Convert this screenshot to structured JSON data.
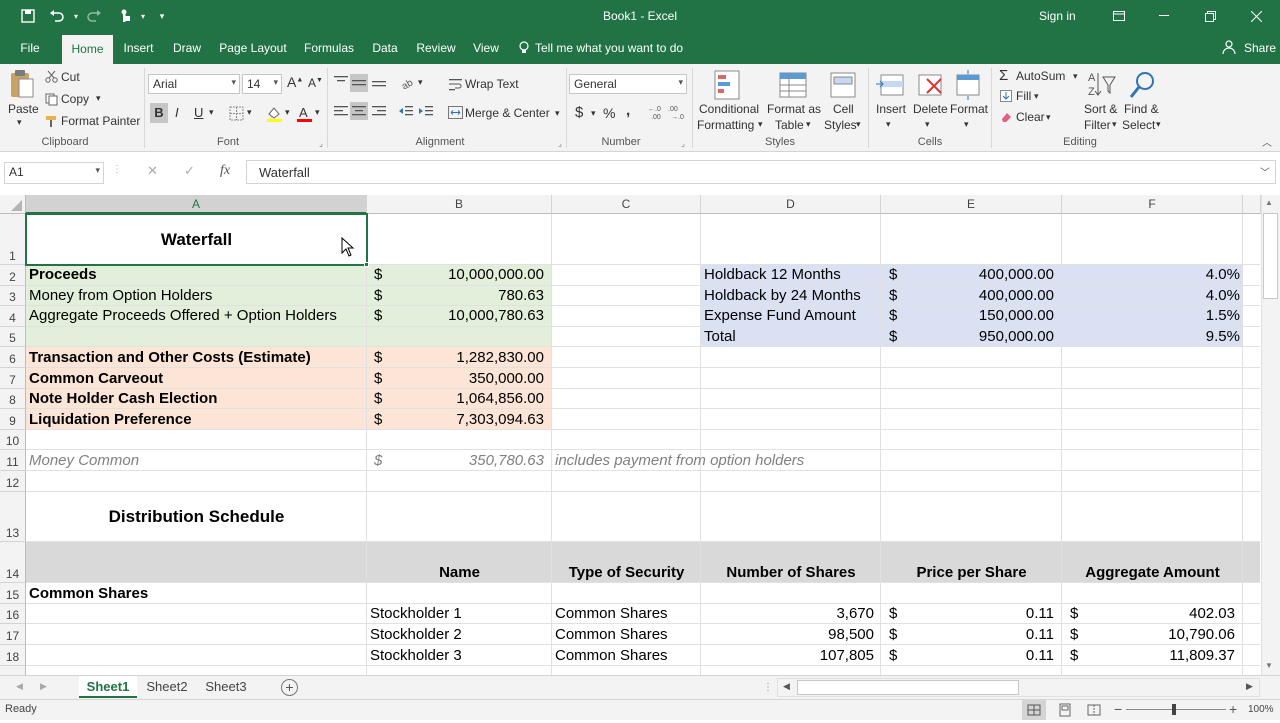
{
  "window": {
    "title": "Book1 - Excel",
    "sign_in": "Sign in"
  },
  "tabs": [
    {
      "label": "File"
    },
    {
      "label": "Home"
    },
    {
      "label": "Insert"
    },
    {
      "label": "Draw"
    },
    {
      "label": "Page Layout"
    },
    {
      "label": "Formulas"
    },
    {
      "label": "Data"
    },
    {
      "label": "Review"
    },
    {
      "label": "View"
    }
  ],
  "tell_me": "Tell me what you want to do",
  "share": "Share",
  "ribbon": {
    "clipboard": {
      "paste": "Paste",
      "cut": "Cut",
      "copy": "Copy",
      "format_painter": "Format Painter",
      "label": "Clipboard"
    },
    "font": {
      "name": "Arial",
      "size": "14",
      "bold": "B",
      "italic": "I",
      "underline": "U",
      "label": "Font"
    },
    "alignment": {
      "wrap_text": "Wrap Text",
      "merge_center": "Merge & Center",
      "label": "Alignment"
    },
    "number": {
      "format": "General",
      "currency": "$",
      "percent": "%",
      "comma": ",",
      "label": "Number"
    },
    "styles": {
      "conditional": "Conditional",
      "conditional2": "Formatting",
      "format_as": "Format as",
      "format_as2": "Table",
      "cell": "Cell",
      "cell2": "Styles",
      "label": "Styles"
    },
    "cells": {
      "insert": "Insert",
      "delete": "Delete",
      "format": "Format",
      "label": "Cells"
    },
    "editing": {
      "autosum": "AutoSum",
      "fill": "Fill",
      "clear": "Clear",
      "sort": "Sort &",
      "sort2": "Filter",
      "find": "Find &",
      "find2": "Select",
      "label": "Editing"
    }
  },
  "formula_bar": {
    "name_box": "A1",
    "fx": "fx",
    "content": "Waterfall"
  },
  "columns": [
    "A",
    "B",
    "C",
    "D",
    "E",
    "F"
  ],
  "rows": {
    "r1": {
      "n": "1",
      "a": "Waterfall"
    },
    "r2": {
      "n": "2",
      "a": "Proceeds",
      "b1": "$",
      "b2": "10,000,000.00",
      "d": "Holdback 12 Months",
      "e1": "$",
      "e2": "400,000.00",
      "f": "4.0%"
    },
    "r3": {
      "n": "3",
      "a": "Money from Option Holders",
      "b1": "$",
      "b2": "780.63",
      "d": "Holdback by 24 Months",
      "e1": "$",
      "e2": "400,000.00",
      "f": "4.0%"
    },
    "r4": {
      "n": "4",
      "a": "Aggregate Proceeds Offered + Option Holders",
      "b1": "$",
      "b2": "10,000,780.63",
      "d": "Expense Fund Amount",
      "e1": "$",
      "e2": "150,000.00",
      "f": "1.5%"
    },
    "r5": {
      "n": "5",
      "d": "Total",
      "e1": "$",
      "e2": "950,000.00",
      "f": "9.5%"
    },
    "r6": {
      "n": "6",
      "a": "Transaction and Other Costs (Estimate)",
      "b1": "$",
      "b2": "1,282,830.00"
    },
    "r7": {
      "n": "7",
      "a": "Common Carveout",
      "b1": "$",
      "b2": "350,000.00"
    },
    "r8": {
      "n": "8",
      "a": "Note Holder Cash Election",
      "b1": "$",
      "b2": "1,064,856.00"
    },
    "r9": {
      "n": "9",
      "a": "Liquidation Preference",
      "b1": "$",
      "b2": "7,303,094.63"
    },
    "r10": {
      "n": "10"
    },
    "r11": {
      "n": "11",
      "a": "Money Common",
      "b1": "$",
      "b2": "350,780.63",
      "c": "includes payment from option holders"
    },
    "r12": {
      "n": "12"
    },
    "r13": {
      "n": "13",
      "a": "Distribution Schedule"
    },
    "r14": {
      "n": "14",
      "b": "Name",
      "c": "Type of Security",
      "d": "Number of Shares",
      "e": "Price per Share",
      "f": "Aggregate Amount"
    },
    "r15": {
      "n": "15",
      "a": "Common Shares"
    },
    "r16": {
      "n": "16",
      "b": "Stockholder 1",
      "c": "Common Shares",
      "d": "3,670",
      "e1": "$",
      "e2": "0.11",
      "f1": "$",
      "f2": "402.03"
    },
    "r17": {
      "n": "17",
      "b": "Stockholder 2",
      "c": "Common Shares",
      "d": "98,500",
      "e1": "$",
      "e2": "0.11",
      "f1": "$",
      "f2": "10,790.06"
    },
    "r18": {
      "n": "18",
      "b": "Stockholder 3",
      "c": "Common Shares",
      "d": "107,805",
      "e1": "$",
      "e2": "0.11",
      "f1": "$",
      "f2": "11,809.37"
    }
  },
  "sheets": [
    "Sheet1",
    "Sheet2",
    "Sheet3"
  ],
  "status": {
    "ready": "Ready",
    "zoom": "100%"
  },
  "colors": {
    "green": "#217346",
    "proceeds_fill": "#e2efda",
    "costs_fill": "#fce4d6",
    "holdback_fill": "#d9e1f2",
    "header_fill": "#d9d9d9"
  }
}
